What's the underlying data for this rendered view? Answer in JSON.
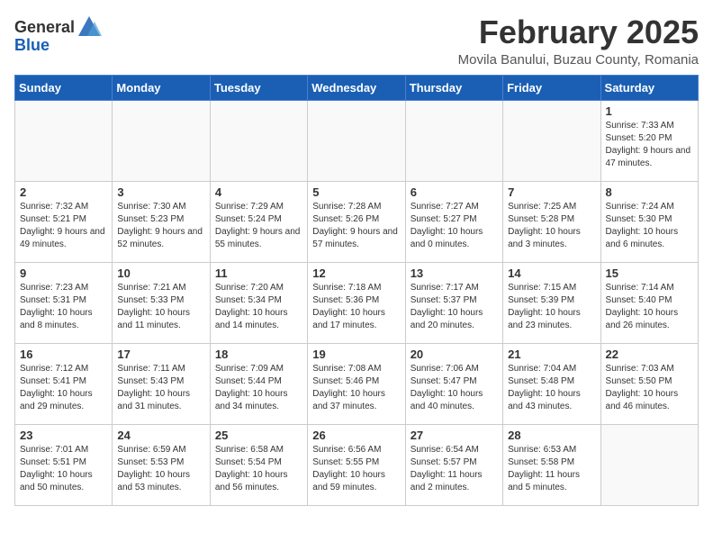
{
  "header": {
    "logo_general": "General",
    "logo_blue": "Blue",
    "month": "February 2025",
    "location": "Movila Banului, Buzau County, Romania"
  },
  "weekdays": [
    "Sunday",
    "Monday",
    "Tuesday",
    "Wednesday",
    "Thursday",
    "Friday",
    "Saturday"
  ],
  "weeks": [
    [
      {
        "day": "",
        "info": ""
      },
      {
        "day": "",
        "info": ""
      },
      {
        "day": "",
        "info": ""
      },
      {
        "day": "",
        "info": ""
      },
      {
        "day": "",
        "info": ""
      },
      {
        "day": "",
        "info": ""
      },
      {
        "day": "1",
        "info": "Sunrise: 7:33 AM\nSunset: 5:20 PM\nDaylight: 9 hours and 47 minutes."
      }
    ],
    [
      {
        "day": "2",
        "info": "Sunrise: 7:32 AM\nSunset: 5:21 PM\nDaylight: 9 hours and 49 minutes."
      },
      {
        "day": "3",
        "info": "Sunrise: 7:30 AM\nSunset: 5:23 PM\nDaylight: 9 hours and 52 minutes."
      },
      {
        "day": "4",
        "info": "Sunrise: 7:29 AM\nSunset: 5:24 PM\nDaylight: 9 hours and 55 minutes."
      },
      {
        "day": "5",
        "info": "Sunrise: 7:28 AM\nSunset: 5:26 PM\nDaylight: 9 hours and 57 minutes."
      },
      {
        "day": "6",
        "info": "Sunrise: 7:27 AM\nSunset: 5:27 PM\nDaylight: 10 hours and 0 minutes."
      },
      {
        "day": "7",
        "info": "Sunrise: 7:25 AM\nSunset: 5:28 PM\nDaylight: 10 hours and 3 minutes."
      },
      {
        "day": "8",
        "info": "Sunrise: 7:24 AM\nSunset: 5:30 PM\nDaylight: 10 hours and 6 minutes."
      }
    ],
    [
      {
        "day": "9",
        "info": "Sunrise: 7:23 AM\nSunset: 5:31 PM\nDaylight: 10 hours and 8 minutes."
      },
      {
        "day": "10",
        "info": "Sunrise: 7:21 AM\nSunset: 5:33 PM\nDaylight: 10 hours and 11 minutes."
      },
      {
        "day": "11",
        "info": "Sunrise: 7:20 AM\nSunset: 5:34 PM\nDaylight: 10 hours and 14 minutes."
      },
      {
        "day": "12",
        "info": "Sunrise: 7:18 AM\nSunset: 5:36 PM\nDaylight: 10 hours and 17 minutes."
      },
      {
        "day": "13",
        "info": "Sunrise: 7:17 AM\nSunset: 5:37 PM\nDaylight: 10 hours and 20 minutes."
      },
      {
        "day": "14",
        "info": "Sunrise: 7:15 AM\nSunset: 5:39 PM\nDaylight: 10 hours and 23 minutes."
      },
      {
        "day": "15",
        "info": "Sunrise: 7:14 AM\nSunset: 5:40 PM\nDaylight: 10 hours and 26 minutes."
      }
    ],
    [
      {
        "day": "16",
        "info": "Sunrise: 7:12 AM\nSunset: 5:41 PM\nDaylight: 10 hours and 29 minutes."
      },
      {
        "day": "17",
        "info": "Sunrise: 7:11 AM\nSunset: 5:43 PM\nDaylight: 10 hours and 31 minutes."
      },
      {
        "day": "18",
        "info": "Sunrise: 7:09 AM\nSunset: 5:44 PM\nDaylight: 10 hours and 34 minutes."
      },
      {
        "day": "19",
        "info": "Sunrise: 7:08 AM\nSunset: 5:46 PM\nDaylight: 10 hours and 37 minutes."
      },
      {
        "day": "20",
        "info": "Sunrise: 7:06 AM\nSunset: 5:47 PM\nDaylight: 10 hours and 40 minutes."
      },
      {
        "day": "21",
        "info": "Sunrise: 7:04 AM\nSunset: 5:48 PM\nDaylight: 10 hours and 43 minutes."
      },
      {
        "day": "22",
        "info": "Sunrise: 7:03 AM\nSunset: 5:50 PM\nDaylight: 10 hours and 46 minutes."
      }
    ],
    [
      {
        "day": "23",
        "info": "Sunrise: 7:01 AM\nSunset: 5:51 PM\nDaylight: 10 hours and 50 minutes."
      },
      {
        "day": "24",
        "info": "Sunrise: 6:59 AM\nSunset: 5:53 PM\nDaylight: 10 hours and 53 minutes."
      },
      {
        "day": "25",
        "info": "Sunrise: 6:58 AM\nSunset: 5:54 PM\nDaylight: 10 hours and 56 minutes."
      },
      {
        "day": "26",
        "info": "Sunrise: 6:56 AM\nSunset: 5:55 PM\nDaylight: 10 hours and 59 minutes."
      },
      {
        "day": "27",
        "info": "Sunrise: 6:54 AM\nSunset: 5:57 PM\nDaylight: 11 hours and 2 minutes."
      },
      {
        "day": "28",
        "info": "Sunrise: 6:53 AM\nSunset: 5:58 PM\nDaylight: 11 hours and 5 minutes."
      },
      {
        "day": "",
        "info": ""
      }
    ]
  ]
}
